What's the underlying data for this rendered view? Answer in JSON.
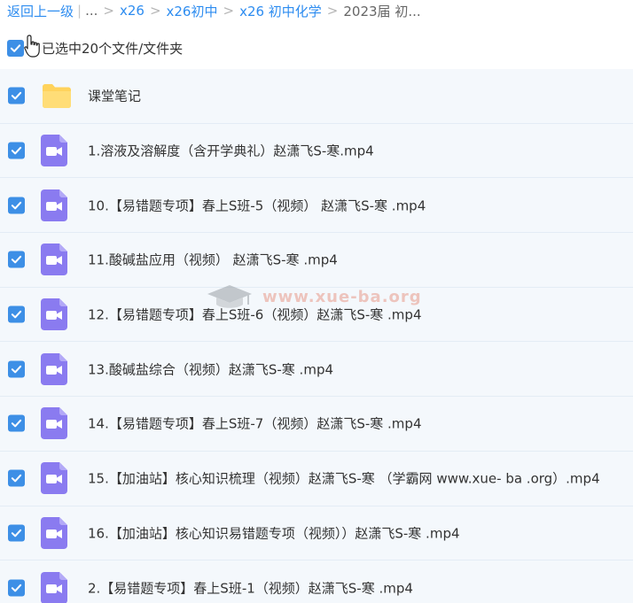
{
  "breadcrumb": {
    "back": "返回上一级",
    "divider": "|",
    "ellipsis": "...",
    "crumbs": [
      "x26",
      "x26初中",
      "x26 初中化学"
    ],
    "current": "2023届 初..."
  },
  "selection": {
    "label": "已选中20个文件/文件夹",
    "checked": true
  },
  "files": [
    {
      "type": "folder",
      "name": "课堂笔记",
      "checked": true
    },
    {
      "type": "video",
      "name": "1.溶液及溶解度（含开学典礼）赵潇飞S-寒.mp4",
      "checked": true
    },
    {
      "type": "video",
      "name": "10.【易错题专项】春上S班-5（视频） 赵潇飞S-寒 .mp4",
      "checked": true
    },
    {
      "type": "video",
      "name": "11.酸碱盐应用（视频） 赵潇飞S-寒 .mp4",
      "checked": true
    },
    {
      "type": "video",
      "name": "12.【易错题专项】春上S班-6（视频）赵潇飞S-寒 .mp4",
      "checked": true
    },
    {
      "type": "video",
      "name": "13.酸碱盐综合（视频）赵潇飞S-寒 .mp4",
      "checked": true
    },
    {
      "type": "video",
      "name": "14.【易错题专项】春上S班-7（视频）赵潇飞S-寒 .mp4",
      "checked": true
    },
    {
      "type": "video",
      "name": "15.【加油站】核心知识梳理（视频）赵潇飞S-寒 （学霸网 www.xue- ba .org）.mp4",
      "checked": true
    },
    {
      "type": "video",
      "name": "16.【加油站】核心知识易错题专项（视频））赵潇飞S-寒 .mp4",
      "checked": true
    },
    {
      "type": "video",
      "name": "2.【易错题专项】春上S班-1（视频）赵潇飞S-寒 .mp4",
      "checked": true
    }
  ],
  "watermark": {
    "text": "www.xue-ba.org"
  },
  "colors": {
    "link": "#2d8cf0",
    "checkbox": "#3d8fe6",
    "folder": "#ffd35c",
    "video": "#8a7bf0",
    "row_bg": "#f4f8fc"
  }
}
